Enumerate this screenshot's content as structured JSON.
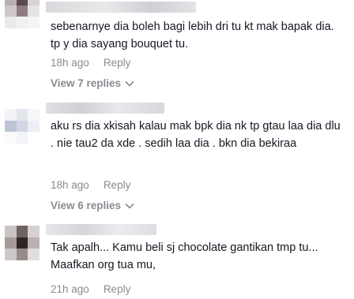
{
  "comments": [
    {
      "text": "sebenarnye dia boleh bagi lebih dri tu kt mak bapak dia. tp y dia sayang bouquet tu.",
      "time": "18h ago",
      "reply_label": "Reply",
      "view_replies": "View 7 replies"
    },
    {
      "text": "aku rs dia xkisah kalau mak bpk dia nk tp gtau laa dia dlu . nie tau2 da xde . sedih laa dia . bkn dia bekiraa",
      "time": "18h ago",
      "reply_label": "Reply",
      "view_replies": "View 6 replies"
    },
    {
      "text": "Tak apalh... Kamu beli sj chocolate gantikan tmp tu... Maafkan org tua mu,",
      "time": "21h ago",
      "reply_label": "Reply"
    }
  ],
  "colors": {
    "text": "#161823",
    "meta": "#8a8b91",
    "background": "#ffffff"
  },
  "icons": {
    "chevron": "chevron-down-icon",
    "avatar": "pixelated-avatar"
  }
}
